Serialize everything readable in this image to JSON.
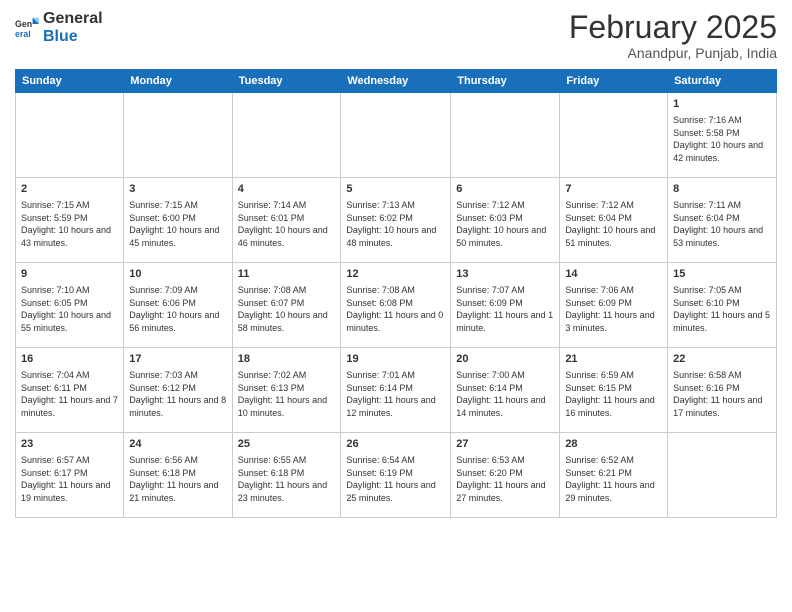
{
  "logo": {
    "general": "General",
    "blue": "Blue"
  },
  "title": {
    "month": "February 2025",
    "location": "Anandpur, Punjab, India"
  },
  "weekdays": [
    "Sunday",
    "Monday",
    "Tuesday",
    "Wednesday",
    "Thursday",
    "Friday",
    "Saturday"
  ],
  "weeks": [
    [
      {
        "day": "",
        "info": ""
      },
      {
        "day": "",
        "info": ""
      },
      {
        "day": "",
        "info": ""
      },
      {
        "day": "",
        "info": ""
      },
      {
        "day": "",
        "info": ""
      },
      {
        "day": "",
        "info": ""
      },
      {
        "day": "1",
        "info": "Sunrise: 7:16 AM\nSunset: 5:58 PM\nDaylight: 10 hours and 42 minutes."
      }
    ],
    [
      {
        "day": "2",
        "info": "Sunrise: 7:15 AM\nSunset: 5:59 PM\nDaylight: 10 hours and 43 minutes."
      },
      {
        "day": "3",
        "info": "Sunrise: 7:15 AM\nSunset: 6:00 PM\nDaylight: 10 hours and 45 minutes."
      },
      {
        "day": "4",
        "info": "Sunrise: 7:14 AM\nSunset: 6:01 PM\nDaylight: 10 hours and 46 minutes."
      },
      {
        "day": "5",
        "info": "Sunrise: 7:13 AM\nSunset: 6:02 PM\nDaylight: 10 hours and 48 minutes."
      },
      {
        "day": "6",
        "info": "Sunrise: 7:12 AM\nSunset: 6:03 PM\nDaylight: 10 hours and 50 minutes."
      },
      {
        "day": "7",
        "info": "Sunrise: 7:12 AM\nSunset: 6:04 PM\nDaylight: 10 hours and 51 minutes."
      },
      {
        "day": "8",
        "info": "Sunrise: 7:11 AM\nSunset: 6:04 PM\nDaylight: 10 hours and 53 minutes."
      }
    ],
    [
      {
        "day": "9",
        "info": "Sunrise: 7:10 AM\nSunset: 6:05 PM\nDaylight: 10 hours and 55 minutes."
      },
      {
        "day": "10",
        "info": "Sunrise: 7:09 AM\nSunset: 6:06 PM\nDaylight: 10 hours and 56 minutes."
      },
      {
        "day": "11",
        "info": "Sunrise: 7:08 AM\nSunset: 6:07 PM\nDaylight: 10 hours and 58 minutes."
      },
      {
        "day": "12",
        "info": "Sunrise: 7:08 AM\nSunset: 6:08 PM\nDaylight: 11 hours and 0 minutes."
      },
      {
        "day": "13",
        "info": "Sunrise: 7:07 AM\nSunset: 6:09 PM\nDaylight: 11 hours and 1 minute."
      },
      {
        "day": "14",
        "info": "Sunrise: 7:06 AM\nSunset: 6:09 PM\nDaylight: 11 hours and 3 minutes."
      },
      {
        "day": "15",
        "info": "Sunrise: 7:05 AM\nSunset: 6:10 PM\nDaylight: 11 hours and 5 minutes."
      }
    ],
    [
      {
        "day": "16",
        "info": "Sunrise: 7:04 AM\nSunset: 6:11 PM\nDaylight: 11 hours and 7 minutes."
      },
      {
        "day": "17",
        "info": "Sunrise: 7:03 AM\nSunset: 6:12 PM\nDaylight: 11 hours and 8 minutes."
      },
      {
        "day": "18",
        "info": "Sunrise: 7:02 AM\nSunset: 6:13 PM\nDaylight: 11 hours and 10 minutes."
      },
      {
        "day": "19",
        "info": "Sunrise: 7:01 AM\nSunset: 6:14 PM\nDaylight: 11 hours and 12 minutes."
      },
      {
        "day": "20",
        "info": "Sunrise: 7:00 AM\nSunset: 6:14 PM\nDaylight: 11 hours and 14 minutes."
      },
      {
        "day": "21",
        "info": "Sunrise: 6:59 AM\nSunset: 6:15 PM\nDaylight: 11 hours and 16 minutes."
      },
      {
        "day": "22",
        "info": "Sunrise: 6:58 AM\nSunset: 6:16 PM\nDaylight: 11 hours and 17 minutes."
      }
    ],
    [
      {
        "day": "23",
        "info": "Sunrise: 6:57 AM\nSunset: 6:17 PM\nDaylight: 11 hours and 19 minutes."
      },
      {
        "day": "24",
        "info": "Sunrise: 6:56 AM\nSunset: 6:18 PM\nDaylight: 11 hours and 21 minutes."
      },
      {
        "day": "25",
        "info": "Sunrise: 6:55 AM\nSunset: 6:18 PM\nDaylight: 11 hours and 23 minutes."
      },
      {
        "day": "26",
        "info": "Sunrise: 6:54 AM\nSunset: 6:19 PM\nDaylight: 11 hours and 25 minutes."
      },
      {
        "day": "27",
        "info": "Sunrise: 6:53 AM\nSunset: 6:20 PM\nDaylight: 11 hours and 27 minutes."
      },
      {
        "day": "28",
        "info": "Sunrise: 6:52 AM\nSunset: 6:21 PM\nDaylight: 11 hours and 29 minutes."
      },
      {
        "day": "",
        "info": ""
      }
    ]
  ]
}
